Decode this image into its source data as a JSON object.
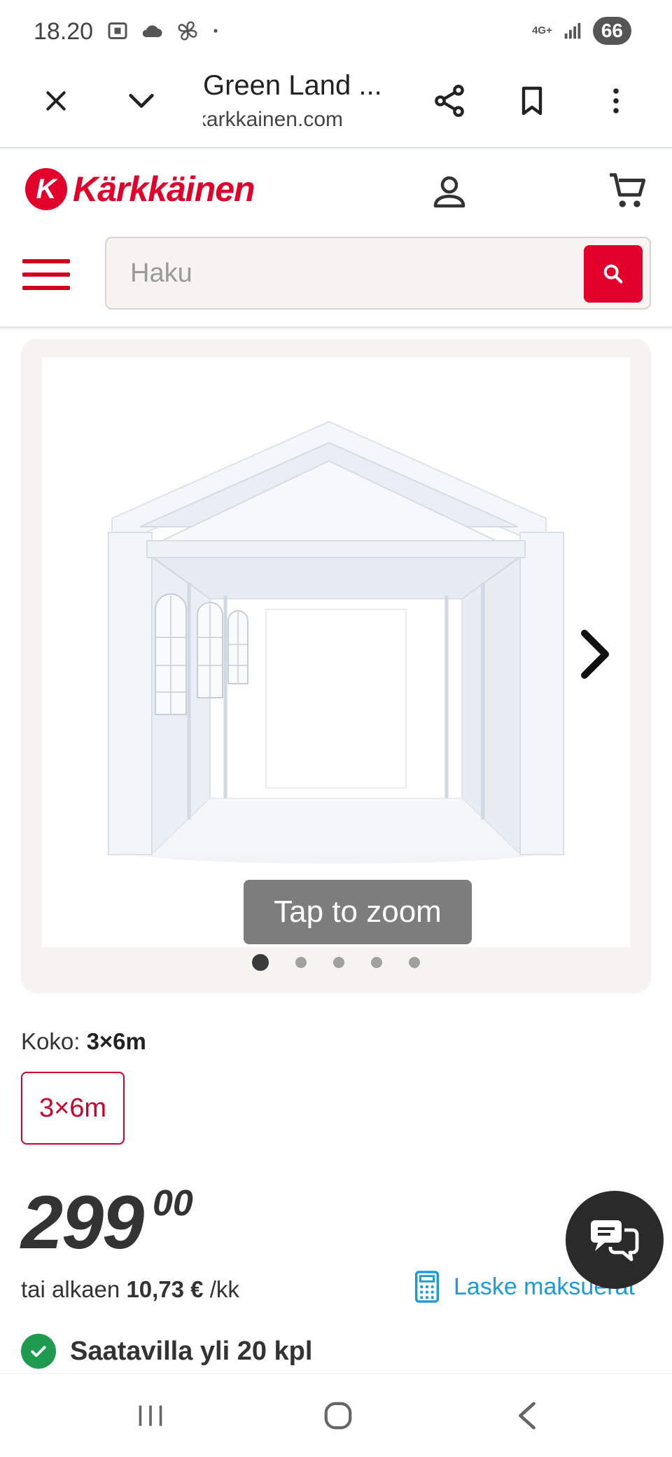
{
  "status_bar": {
    "time": "18.20",
    "network": "4G+",
    "battery": "66"
  },
  "browser": {
    "title": "Green Land ...",
    "url": "karkkainen.com"
  },
  "site": {
    "logo_letter": "K",
    "logo_text": "Kärkkäinen",
    "search_placeholder": "Haku",
    "brand_color": "#e2002b"
  },
  "gallery": {
    "zoom_label": "Tap to zoom",
    "dot_count": 5,
    "active_dot": 0
  },
  "product": {
    "size_label": "Koko:",
    "size_value": "3×6m",
    "size_option": "3×6m",
    "price_int": "299",
    "price_dec": "00",
    "installment_prefix": "tai alkaen",
    "installment_amount": "10,73 €",
    "installment_suffix": "/kk",
    "calc_link": "Laske maksuerat",
    "stock_text": "Saatavilla yli 20 kpl",
    "stock_color": "#1f9b50"
  }
}
